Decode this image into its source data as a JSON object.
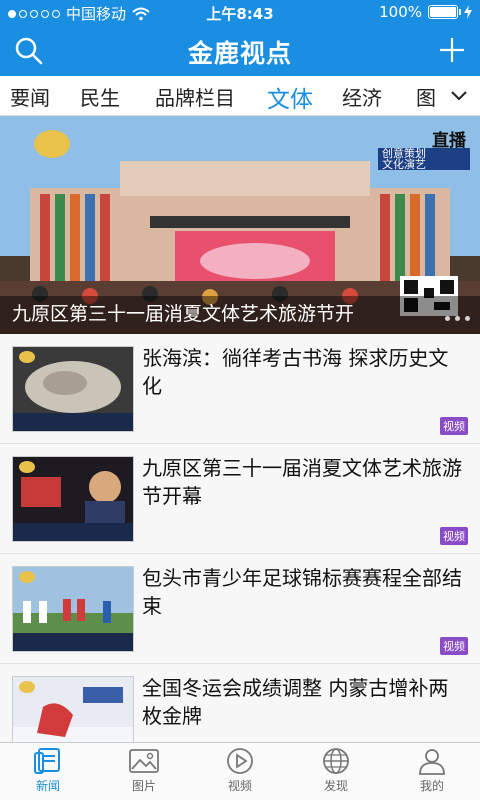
{
  "status_bar": {
    "carrier": "中国移动",
    "time": "上午8:43",
    "battery": "100%"
  },
  "header": {
    "title": "金鹿视点",
    "search_icon": "search-icon",
    "add_icon": "plus-icon"
  },
  "tabs": [
    {
      "label": "要闻"
    },
    {
      "label": "民生"
    },
    {
      "label": "品牌栏目"
    },
    {
      "label": "文体",
      "active": true
    },
    {
      "label": "经济"
    },
    {
      "label": "图"
    }
  ],
  "banner": {
    "caption": "九原区第三十一届消夏文体艺术旅游节开",
    "live_label": "直播",
    "tag_line1": "创意策划",
    "tag_line2": "文化演艺"
  },
  "news": [
    {
      "title": "张海滨：徜徉考古书海 探求历史文化",
      "badge": "视频"
    },
    {
      "title": "九原区第三十一届消夏文体艺术旅游节开幕",
      "badge": "视频"
    },
    {
      "title": "包头市青少年足球锦标赛赛程全部结束",
      "badge": "视频"
    },
    {
      "title": "全国冬运会成绩调整 内蒙古增补两枚金牌",
      "badge": ""
    }
  ],
  "bottom_nav": [
    {
      "label": "新闻",
      "icon": "news-icon",
      "active": true
    },
    {
      "label": "图片",
      "icon": "image-icon"
    },
    {
      "label": "视频",
      "icon": "play-icon"
    },
    {
      "label": "发现",
      "icon": "globe-icon"
    },
    {
      "label": "我的",
      "icon": "user-icon"
    }
  ],
  "colors": {
    "primary": "#1a8ee0",
    "badge": "#8a4bc7"
  }
}
